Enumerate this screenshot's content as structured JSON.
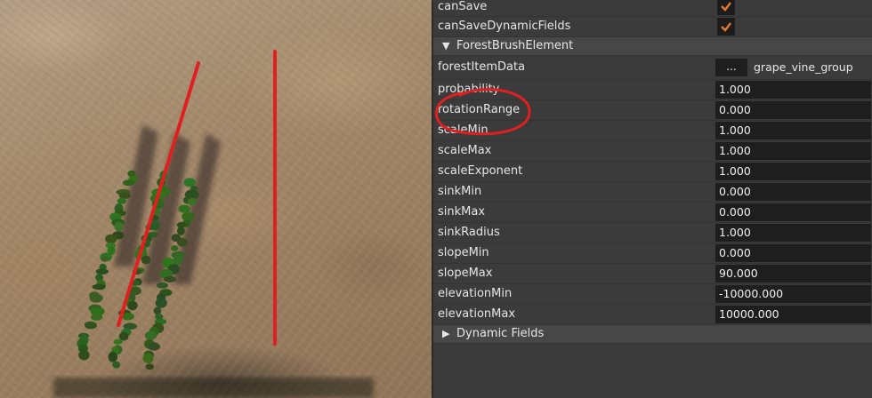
{
  "inspector": {
    "top_rows": [
      {
        "label": "canSave",
        "checked": true
      },
      {
        "label": "canSaveDynamicFields",
        "checked": true
      }
    ],
    "forest_section": {
      "title": "ForestBrushElement",
      "expanded": true
    },
    "forest_item_data": {
      "label": "forestItemData",
      "button_label": "...",
      "value": "grape_vine_group"
    },
    "fields": [
      {
        "label": "probability",
        "value": "1.000"
      },
      {
        "label": "rotationRange",
        "value": "0.000"
      },
      {
        "label": "scaleMin",
        "value": "1.000"
      },
      {
        "label": "scaleMax",
        "value": "1.000"
      },
      {
        "label": "scaleExponent",
        "value": "1.000"
      },
      {
        "label": "sinkMin",
        "value": "0.000"
      },
      {
        "label": "sinkMax",
        "value": "0.000"
      },
      {
        "label": "sinkRadius",
        "value": "1.000"
      },
      {
        "label": "slopeMin",
        "value": "0.000"
      },
      {
        "label": "slopeMax",
        "value": "90.000"
      },
      {
        "label": "elevationMin",
        "value": "-10000.000"
      },
      {
        "label": "elevationMax",
        "value": "10000.000"
      }
    ],
    "dynamic_section": {
      "title": "Dynamic Fields",
      "expanded": false
    },
    "check_color": "#e07a2c"
  },
  "viewport": {
    "annotation_color": "#e02020",
    "annotation_circle_target": "rotationRange"
  }
}
